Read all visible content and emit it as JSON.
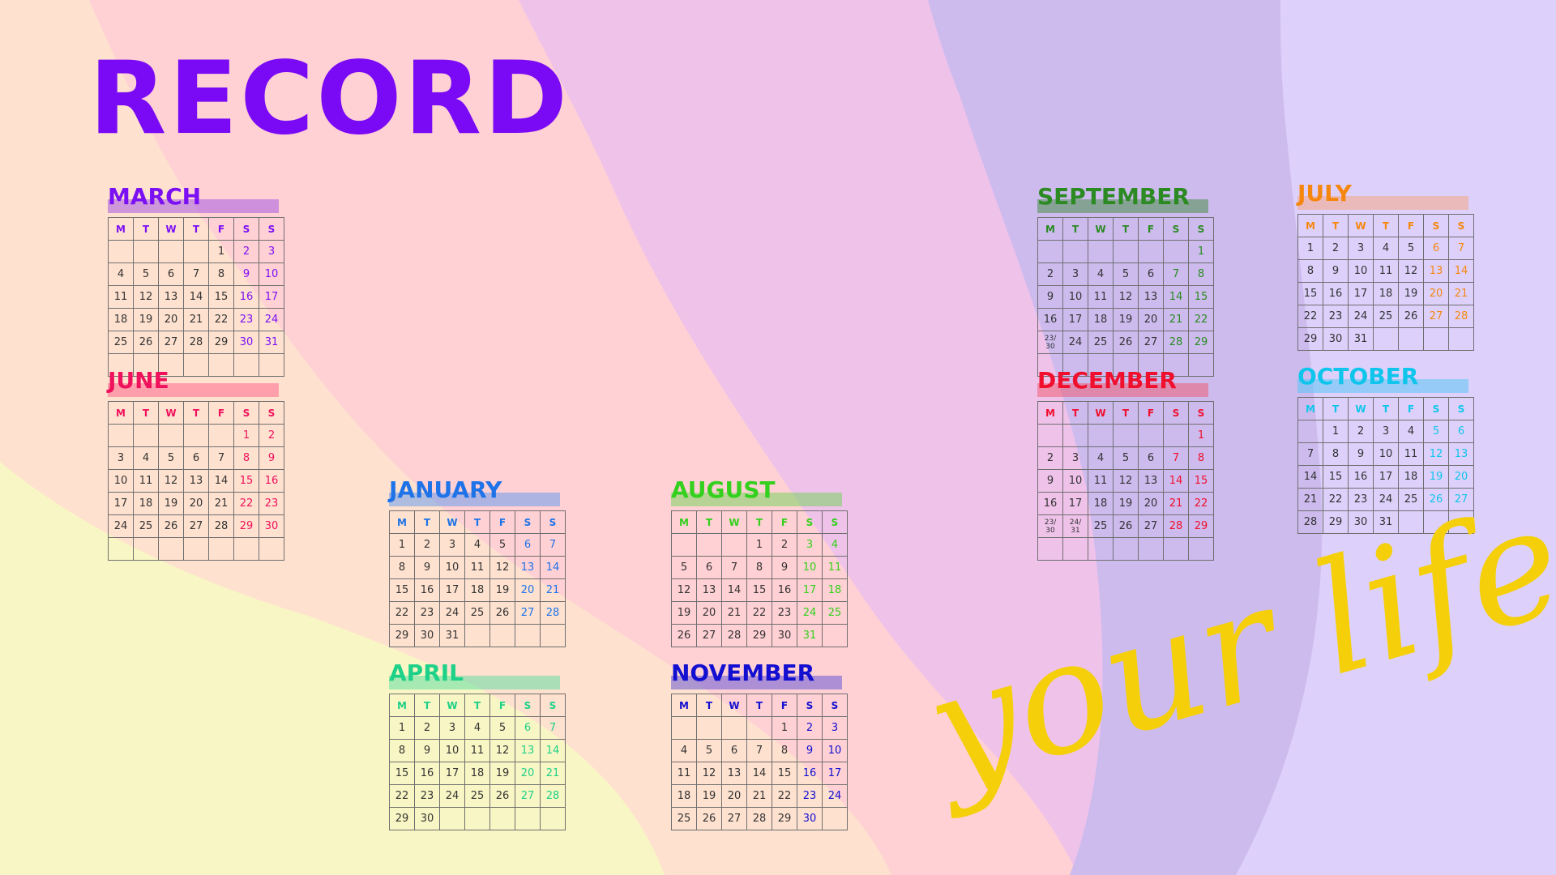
{
  "title": "RECORD",
  "script_text": "your life",
  "colors": {
    "title": "#7a0af5",
    "script": "#f5cf0a",
    "bg_yellow": "#f9f6c5",
    "bg_peach": "#fee1cf",
    "bg_pink": "#ffd0d4",
    "bg_mauve": "#efc2ea",
    "bg_lavender": "#cdbbee",
    "bg_lilac": "#ddd1fb"
  },
  "weekdays": [
    "M",
    "T",
    "W",
    "T",
    "F",
    "S",
    "S"
  ],
  "calendars": [
    {
      "id": "march",
      "name": "MARCH",
      "color": "#7b10f4",
      "bar": "#9d4ee6",
      "start": 4,
      "days": 31,
      "weeks": 6
    },
    {
      "id": "june",
      "name": "JUNE",
      "color": "#f0115c",
      "bar": "#ff5d8a",
      "start": 5,
      "days": 30,
      "weeks": 6
    },
    {
      "id": "january",
      "name": "JANUARY",
      "color": "#1e73e8",
      "bar": "#5e98f0",
      "start": 0,
      "days": 31,
      "weeks": 5
    },
    {
      "id": "april",
      "name": "APRIL",
      "color": "#1ed188",
      "bar": "#55dc9f",
      "start": 0,
      "days": 30,
      "weeks": 5
    },
    {
      "id": "august",
      "name": "AUGUST",
      "color": "#33d01d",
      "bar": "#6ed456",
      "start": 3,
      "days": 31,
      "weeks": 5
    },
    {
      "id": "november",
      "name": "NOVEMBER",
      "color": "#120fd1",
      "bar": "#5a4ed4",
      "start": 4,
      "days": 30,
      "weeks": 5
    },
    {
      "id": "september",
      "name": "SEPTEMBER",
      "color": "#2b8a22",
      "bar": "#3d8a3a",
      "start": 6,
      "days": 30,
      "weeks": 6,
      "merged": {
        "23": "23/\n30"
      }
    },
    {
      "id": "december",
      "name": "DECEMBER",
      "color": "#f00f2d",
      "bar": "#f0566a",
      "start": 6,
      "days": 31,
      "weeks": 6,
      "merged": {
        "23": "23/\n30",
        "24": "24/\n31"
      }
    },
    {
      "id": "july",
      "name": "JULY",
      "color": "#f5870f",
      "bar": "#f7a37a",
      "start": 0,
      "days": 31,
      "weeks": 5
    },
    {
      "id": "october",
      "name": "OCTOBER",
      "color": "#10c5ec",
      "bar": "#4fc5f6",
      "start": 1,
      "days": 31,
      "weeks": 5
    }
  ]
}
